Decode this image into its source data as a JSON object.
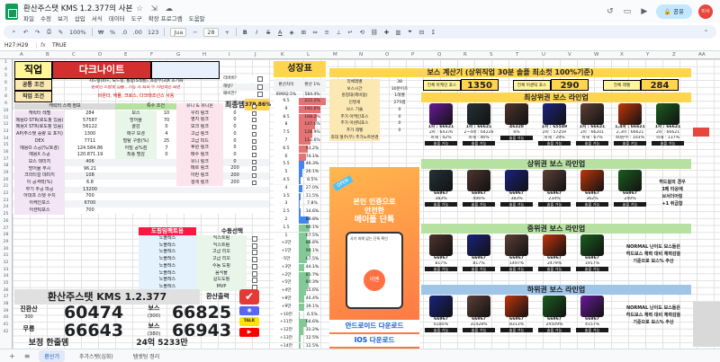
{
  "doc": {
    "title": "환산주스탯 KMS 1.2.377의 사본",
    "menus": [
      "파일",
      "수정",
      "보기",
      "삽입",
      "서식",
      "데이터",
      "도구",
      "확장 프로그램",
      "도움말"
    ],
    "share": "공유",
    "avatar": "미사"
  },
  "toolbar": {
    "zoom": "100%",
    "font": "Jua",
    "font_size": "28",
    "percent": "%",
    "dec1": ".0",
    "dec2": ".00",
    "num": "123"
  },
  "formula": {
    "cell": "H27:H29",
    "value": "TRUE"
  },
  "columns": [
    "A",
    "B",
    "C",
    "D",
    "E",
    "F",
    "G",
    "H",
    "I",
    "J",
    "K",
    "L",
    "M",
    "N",
    "O",
    "P",
    "Q",
    "R",
    "S",
    "T",
    "U",
    "V",
    "W",
    "X",
    "Y",
    "Z",
    "AA"
  ],
  "rows": [
    "1",
    "4",
    "5",
    "6",
    "7",
    "8",
    "9",
    "10",
    "11",
    "12",
    "13",
    "14",
    "15",
    "16",
    "17",
    "18",
    "19",
    "20",
    "21",
    "22",
    "23",
    "24",
    "25",
    "26",
    "27",
    "28",
    "29",
    "30",
    "31",
    "32",
    "33",
    "34",
    "35",
    "36",
    "37",
    "38",
    "39",
    "40",
    "41",
    "42"
  ],
  "left": {
    "job_label": "직업",
    "job_value": "다크나이트",
    "common_label": "공통 조건",
    "common_text": "시드링(4)+, 노드링, 통합(5레벨), 쇼콩부(3)X 초기화",
    "common_text2": "원마인 스칼렛 심볼 , 기능 시 최소 부 시련적인 화면",
    "job_cond_label": "직업 조건",
    "job_cond_text": "비욘더, 애뮬, 크로스, 다크레조넌스 사용",
    "spec_label": "캐릭터 스펙 정보",
    "special_label": "특수 조건",
    "stats": [
      {
        "k": "캐릭터 레벨",
        "v": "284",
        "k2": "보스",
        "v2": "10"
      },
      {
        "k": "메용O STR(로도핑 있음)",
        "v": "57587",
        "k2": "방어율",
        "v2": "70"
      },
      {
        "k": "메용X STR(로도핑 있음)",
        "v": "56122",
        "k2": "쿨감",
        "v2": "0"
      },
      {
        "k": "AP(주스탯 증량 요 포지)",
        "v": "1300",
        "k2": "메구 모경",
        "v2": "4"
      },
      {
        "k": "DEX",
        "v": "7711",
        "k2": "벌탐 구슬(%)",
        "v2": "25"
      },
      {
        "k": "메용O 스공(%/호경)",
        "v": "124.584.86",
        "k2": "어빌 공%점",
        "v2": "7"
      },
      {
        "k": "메용X 스공",
        "v": "120.871.19",
        "k2": "최종 뎀감",
        "v2": "0"
      },
      {
        "k": "보스 데미지",
        "v": "406",
        "k2": "",
        "v2": ""
      },
      {
        "k": "방어율 무시",
        "v": "96.21",
        "k2": "도핑임팩트",
        "v2": ""
      },
      {
        "k": "크리티컬 데미지",
        "v": "108",
        "k2": "",
        "v2": ""
      },
      {
        "k": "이 공격력(%)",
        "v": "6.8",
        "k2": "",
        "v2": ""
      },
      {
        "k": "무기 추공 마공",
        "v": "13200",
        "k2": "",
        "v2": ""
      },
      {
        "k": "아대프 스탯 수치",
        "v": "700",
        "k2": "",
        "v2": ""
      },
      {
        "k": "아케인포스",
        "v": "6700",
        "k2": "",
        "v2": ""
      },
      {
        "k": "어센틱포스",
        "v": "700",
        "k2": "",
        "v2": ""
      }
    ],
    "right_list": [
      {
        "k": "유니 & 유니온",
        "v": ""
      },
      {
        "k": "우리 링크",
        "v": "0"
      },
      {
        "k": "영지 링크",
        "v": "0"
      },
      {
        "k": "모크 링크",
        "v": "0"
      },
      {
        "k": "고급 링크",
        "v": "0"
      },
      {
        "k": "고급 피드",
        "v": "0"
      },
      {
        "k": "후원 링크",
        "v": "0"
      },
      {
        "k": "매수 링크",
        "v": "0"
      },
      {
        "k": "유니 링크",
        "v": "0"
      },
      {
        "k": "메르 링크",
        "v": "200"
      },
      {
        "k": "아란 링크",
        "v": "200"
      },
      {
        "k": "검색 링크",
        "v": "200"
      }
    ],
    "dopping_label": "도핑임팩트용",
    "dopping": [
      "노블레스",
      "노블레스",
      "노블레스",
      "노블레스",
      "노블레스",
      "노블레스",
      "노블레스",
      "노블레스"
    ],
    "manual_label": "수동선택",
    "manual": [
      "익스트림",
      "익스트림",
      "고급 리오",
      "고급 리오",
      "수동 도핑",
      "음식물",
      "길드도핑",
      "MVP"
    ],
    "check_header": [
      "리버버?",
      "해방?",
      "패비만?"
    ],
    "final_label": "최종뎀",
    "final_value": "379.86%",
    "title_big": "환산주스탯 KMS 1.2.377",
    "hwansan_btn": "환산출력",
    "jinhwan_label": "진환산",
    "jinhwan_sub": "300",
    "jinhwan_value": "60474",
    "boss_label1": "보스",
    "boss_sub1": "(300)",
    "boss_value1": "66825",
    "mureung_label": "무릉",
    "mureung_value": "66643",
    "boss_label2": "보스",
    "boss_sub2": "(380)",
    "boss_value2": "66943",
    "bojeong_label": "보정 한줄뎀",
    "bojeong_value": "24억 5233만",
    "footer_headers": [
      "주스탯 무 변환",
      "공격력",
      "크리티컬 데미지",
      "보스 데미지",
      "방어율 무시",
      "주스탯%"
    ],
    "footer_values": [
      "6.21",
      "6.49",
      "4.6",
      "7.64",
      "2.15",
      "537%"
    ],
    "mubo_label1": "무보엠블렘 6.05 만급",
    "mubo_label2": "무보엠 6.77 만급"
  },
  "growth": {
    "title": "성장표",
    "col_a": "환산차이",
    "col_b": "환산 1%",
    "top": [
      "IRMA2.5%",
      "584.4%"
    ],
    "rows": [
      {
        "a": "9.5",
        "b": "222.1%"
      },
      {
        "a": "9",
        "b": "192.6%"
      },
      {
        "a": "8.5",
        "b": "168.2%"
      },
      {
        "a": "8",
        "b": "147.6%"
      },
      {
        "a": "7.5",
        "b": "128.9%"
      },
      {
        "a": "7",
        "b": "112.6%"
      },
      {
        "a": "6.5",
        "b": "93.2%"
      },
      {
        "a": "6",
        "b": "74.1%"
      },
      {
        "a": "5.5",
        "b": "46.3%"
      },
      {
        "a": "5",
        "b": "26.1%"
      },
      {
        "a": "4.5",
        "b": "8.5%"
      },
      {
        "a": "4",
        "b": "27.0%"
      },
      {
        "a": "3.5",
        "b": "11.5%"
      },
      {
        "a": "3",
        "b": "7.8%"
      },
      {
        "a": "2.5",
        "b": "14.6%"
      },
      {
        "a": "2",
        "b": "88.8%"
      },
      {
        "a": "1.5",
        "b": "90.1%"
      },
      {
        "a": "1",
        "b": "67.5%"
      },
      {
        "a": "+2만",
        "b": "88.8%"
      },
      {
        "a": "+1만",
        "b": "90.1%"
      },
      {
        "a": "-5만",
        "b": "67.5%"
      },
      {
        "a": "+3만",
        "b": "44.1%"
      },
      {
        "a": "+2만",
        "b": "81.7%"
      },
      {
        "a": "+5만",
        "b": "80.3%"
      },
      {
        "a": "+4만",
        "b": "55.6%"
      },
      {
        "a": "+8만",
        "b": "44.4%"
      },
      {
        "a": "+9만",
        "b": "39.1%"
      },
      {
        "a": "+10만",
        "b": "6.5%"
      },
      {
        "a": "+11만",
        "b": "64.6%"
      },
      {
        "a": "+12만",
        "b": "31.2%"
      },
      {
        "a": "+13만",
        "b": "12.5%"
      },
      {
        "a": "+14만",
        "b": "12.5%"
      }
    ],
    "bar_values": [
      65,
      52,
      44,
      38,
      33,
      28,
      22,
      18,
      12,
      8,
      4,
      8,
      5,
      3,
      5,
      24,
      26,
      20,
      26,
      27,
      20,
      13,
      25,
      24,
      17,
      13,
      12,
      3,
      20,
      10,
      5,
      5
    ]
  },
  "calc": {
    "title": "보스 계산기 (상위직업 30분 솔플 최소컷 100%기준)",
    "params": [
      {
        "k": "리체레벨",
        "v": "38"
      },
      {
        "k": "보스시간",
        "v": "30분이츠"
      },
      {
        "k": "원정대(헤비탐)",
        "v": "1레벨"
      },
      {
        "k": "인텐세",
        "v": "275렙"
      },
      {
        "k": "보스 기술",
        "v": "0"
      },
      {
        "k": "추가 아케인포스",
        "v": "0"
      },
      {
        "k": "추가 어센틱포스",
        "v": "0"
      },
      {
        "k": "추가 레벨",
        "v": "0"
      },
      {
        "k": "최대 절주(부) 추가노트변경",
        "v": ""
      }
    ],
    "need": [
      {
        "k": "전체 아케인 포스",
        "v": "1350"
      },
      {
        "k": "전체 어센틱 포스",
        "v": "290"
      },
      {
        "k": "전체 레벨",
        "v": "284"
      }
    ],
    "ad": {
      "badge": "OPEN",
      "t1": "본인 인증으로",
      "t2": "안전한",
      "t3": "메이플 단톡",
      "sub": "사기 피해 없는 단톡 확인",
      "android": "안드로이드 다운로드",
      "ios": "IOS 다운로드",
      "brand": "이벤"
    }
  },
  "lines": [
    {
      "title": "최상위권 보스 라인업",
      "cards": [
        {
          "a": "1파 : 66621",
          "b": "2파 : 64376",
          "c": "피해 : 42%"
        },
        {
          "a": "1파 : 66621",
          "b": "2~4파 : 64226",
          "c": "피해 : 46%"
        },
        {
          "a": "46328",
          "b": "",
          "c": "6%"
        },
        {
          "a": "1파 : 65549",
          "b": "2파 : 57259",
          "c": "피해 : 29%"
        },
        {
          "a": "1파 : 66621",
          "b": "2파 : 66201",
          "c": "피해 : 67%"
        },
        {
          "a": "1,4파 : 66621",
          "b": "2,3파 : 66621",
          "c": "40분주 : 103%"
        },
        {
          "a": "1파 : 66621",
          "b": "2파 : 66621",
          "c": "피해 : 137%"
        }
      ],
      "tags": [
        "솔플 가능",
        "솔플 가능",
        "솔플 가능",
        "솔플 가능",
        "솔플 가능",
        "솔플 가능",
        "솔플 가능"
      ]
    },
    {
      "title": "상위권 보스 라인업",
      "cards": [
        {
          "a": "66967",
          "c": "383%"
        },
        {
          "a": "66967",
          "c": "406%"
        },
        {
          "a": "66967",
          "c": "383%"
        },
        {
          "a": "66967",
          "c": "234%"
        },
        {
          "a": "66967",
          "c": "362%"
        },
        {
          "a": "66967",
          "c": "240%"
        }
      ],
      "note": [
        "하드윌의 경우",
        "3페 타운에",
        "브서더어링",
        "+1 취급함"
      ],
      "tags": [
        "솔플 가능",
        "솔플 가능",
        "솔플 가능",
        "솔플 가능",
        "솔플 가능",
        "솔플 가능"
      ]
    },
    {
      "title": "중위권 보스 라인업",
      "cards": [
        {
          "a": "66967",
          "c": "817%"
        },
        {
          "a": "66967",
          "c": "817%"
        },
        {
          "a": "66967",
          "c": "1497%"
        },
        {
          "a": "66967",
          "c": "2479%"
        },
        {
          "a": "66967",
          "c": "1917%"
        }
      ],
      "note": [
        "NORMAL 난이도 보스들은",
        "하드보스 체력 대비 체력감을",
        "기준으로 보스% 추산"
      ],
      "tags": [
        "솔플 가능",
        "솔플 가능",
        "솔플 가능",
        "솔플 가능",
        "솔플 가능"
      ]
    },
    {
      "title": "하위권 보스 라인업",
      "cards": [
        {
          "a": "66967",
          "c": "6185%"
        },
        {
          "a": "66967",
          "c": "31428%"
        },
        {
          "a": "66967",
          "c": "8313%"
        },
        {
          "a": "66967",
          "c": "24509%"
        },
        {
          "a": "66967",
          "c": "4157%"
        }
      ],
      "note": [
        "NORMAL 난이도 보스들은",
        "하드보스 체력 대비 체력감을",
        "기준으로 보스% 추산"
      ],
      "tags": [
        "솔플 가능",
        "솔플 가능",
        "솔플 가능",
        "솔플 가능",
        "솔플 가능"
      ]
    }
  ],
  "colors": {
    "yellow": "#ffd54f",
    "green_band": "#b7e1a1",
    "red_band": "#d32f2f",
    "pink": "#f8bbd0",
    "blue_band": "#9fc5e8",
    "gray_band": "#d9d9d9"
  },
  "tabs": {
    "items": [
      "환산기",
      "추가스탯(심화)",
      "템셋팅 정리"
    ],
    "add_icon": "plus-icon",
    "list_icon": "list-icon"
  }
}
